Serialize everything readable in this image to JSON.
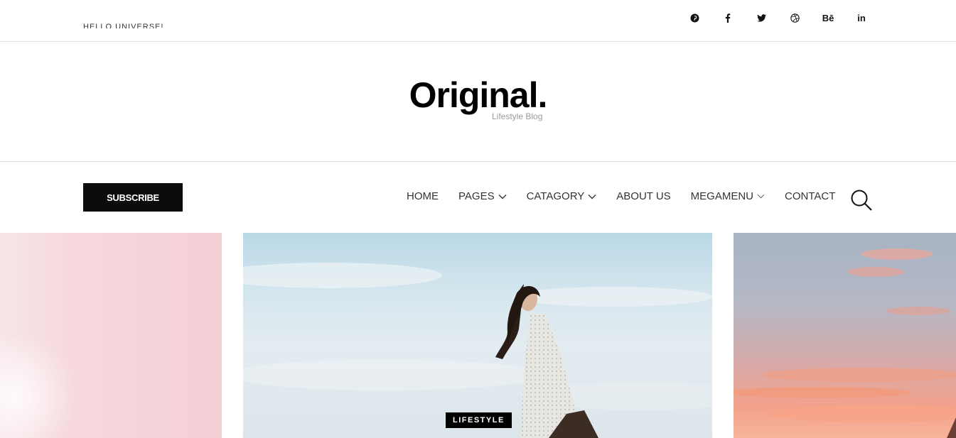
{
  "topbar": {
    "ticker_text": "HELLO UNIVERSE!",
    "social": [
      {
        "icon": "pinterest-icon"
      },
      {
        "icon": "facebook-icon"
      },
      {
        "icon": "twitter-icon"
      },
      {
        "icon": "dribbble-icon"
      },
      {
        "icon": "behance-icon",
        "label": "Bē"
      },
      {
        "icon": "linkedin-icon",
        "label": "in"
      }
    ]
  },
  "header": {
    "logo": "Original.",
    "tagline": "Lifestyle Blog"
  },
  "nav": {
    "subscribe_label": "SUBSCRIBE",
    "items": [
      {
        "label": "HOME"
      },
      {
        "label": "PAGES"
      },
      {
        "label": "CATAGORY"
      },
      {
        "label": "ABOUT US"
      },
      {
        "label": "MEGAMENU"
      },
      {
        "label": "CONTACT"
      }
    ]
  },
  "slider": {
    "badge": "LIFESTYLE"
  },
  "colors": {
    "dark": "#0c0c0c",
    "muted": "#9a9a9a",
    "border": "#e2e2e2"
  }
}
